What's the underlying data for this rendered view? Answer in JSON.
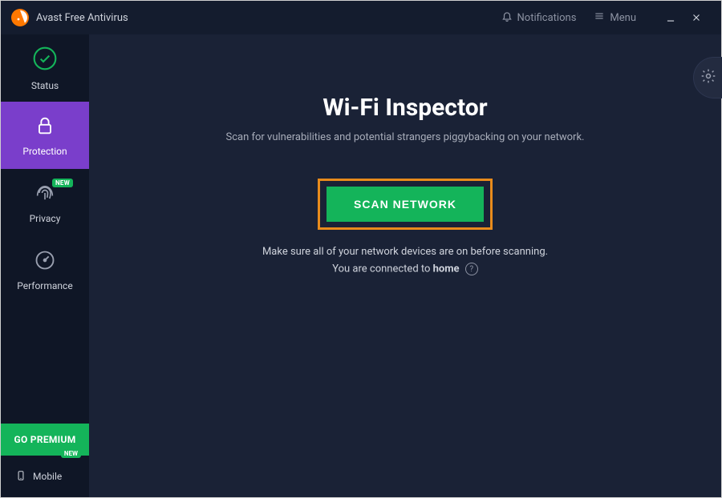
{
  "titlebar": {
    "app_title": "Avast Free Antivirus",
    "notifications_label": "Notifications",
    "menu_label": "Menu"
  },
  "sidebar": {
    "items": [
      {
        "label": "Status"
      },
      {
        "label": "Protection"
      },
      {
        "label": "Privacy",
        "badge": "NEW"
      },
      {
        "label": "Performance"
      }
    ],
    "premium_label": "GO PREMIUM",
    "mobile_label": "Mobile",
    "mobile_badge": "NEW"
  },
  "main": {
    "title": "Wi-Fi Inspector",
    "subtitle": "Scan for vulnerabilities and potential strangers piggybacking on your network.",
    "scan_button_label": "SCAN NETWORK",
    "hint1": "Make sure all of your network devices are on before scanning.",
    "hint2_prefix": "You are connected to ",
    "hint2_network": "home",
    "help_symbol": "?"
  },
  "colors": {
    "accent_purple": "#7a3ecb",
    "accent_green": "#14b45a",
    "highlight_orange": "#e88b1c",
    "bg_dark": "#1a2236"
  }
}
